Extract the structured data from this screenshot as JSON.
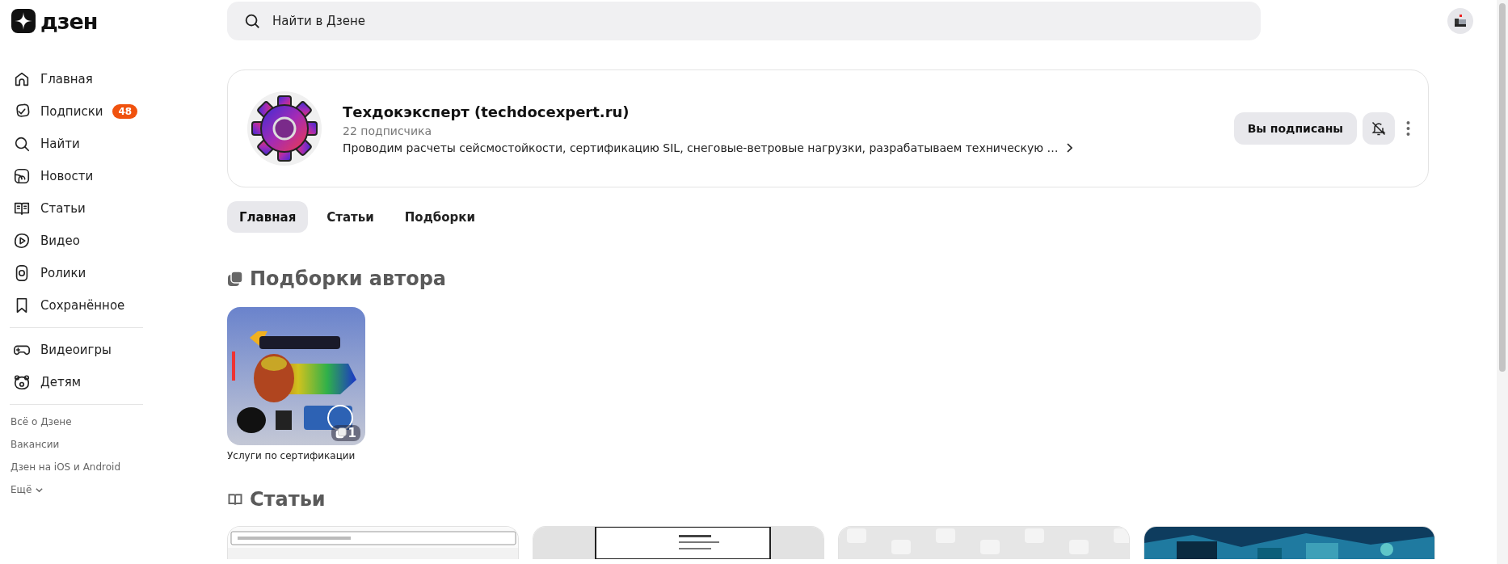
{
  "logo": {
    "text": "дзен"
  },
  "sidebar": {
    "items": [
      {
        "label": "Главная"
      },
      {
        "label": "Подписки",
        "badge": "48"
      },
      {
        "label": "Найти"
      },
      {
        "label": "Новости"
      },
      {
        "label": "Статьи"
      },
      {
        "label": "Видео"
      },
      {
        "label": "Ролики"
      },
      {
        "label": "Сохранённое"
      }
    ],
    "items_2": [
      {
        "label": "Видеоигры"
      },
      {
        "label": "Детям"
      }
    ],
    "footer_links": [
      "Всё о Дзене",
      "Вакансии",
      "Дзен на iOS и Android"
    ],
    "more": "Ещё"
  },
  "search": {
    "placeholder": "Найти в Дзене"
  },
  "channel": {
    "name": "Техдокэксперт (techdocexpert.ru)",
    "subscribers": "22 подписчика",
    "description": "Проводим расчеты сейсмостойкости, сертификацию SIL, снеговые-ветровые нагрузки, разрабатываем техническую …",
    "subscribe_button": "Вы подписаны"
  },
  "tabs": [
    {
      "label": "Главная",
      "selected": true
    },
    {
      "label": "Статьи",
      "selected": false
    },
    {
      "label": "Подборки",
      "selected": false
    }
  ],
  "collections": {
    "title": "Подборки автора",
    "items": [
      {
        "title": "Услуги по сертификации",
        "count": "1",
        "kind": "picture"
      }
    ]
  },
  "articles": {
    "title": "Статьи",
    "items": [
      {
        "kind": "picture"
      },
      {
        "kind": "picture"
      },
      {
        "kind": "placeholder"
      },
      {
        "kind": "picture"
      }
    ]
  }
}
